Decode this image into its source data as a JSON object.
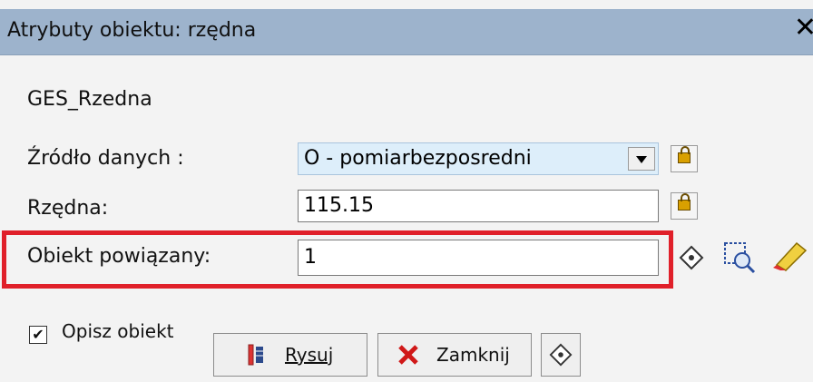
{
  "window": {
    "title": "Atrybuty obiektu: rzędna",
    "close_label": "✕"
  },
  "object_name": "GES_Rzedna",
  "fields": {
    "zrodlo": {
      "label": "Źródło  danych :",
      "value": "O - pomiarbezposredni"
    },
    "rzedna": {
      "label": "Rzędna:",
      "value": "115.15"
    },
    "obiekt": {
      "label": "Obiekt powiązany:",
      "value": "1"
    }
  },
  "checkbox": {
    "label": "Opisz obiekt",
    "checked": true,
    "mark": "✔"
  },
  "buttons": {
    "rysuj": "Rysuj",
    "zamknij": "Zamknij"
  },
  "icons": [
    "lock-icon",
    "target-icon",
    "select-objects-icon",
    "eraser-icon",
    "draw-icon",
    "close-x-icon"
  ],
  "colors": {
    "titlebar": "#9db3cc",
    "highlight": "#e0202a",
    "combo": "#ddeefa"
  }
}
